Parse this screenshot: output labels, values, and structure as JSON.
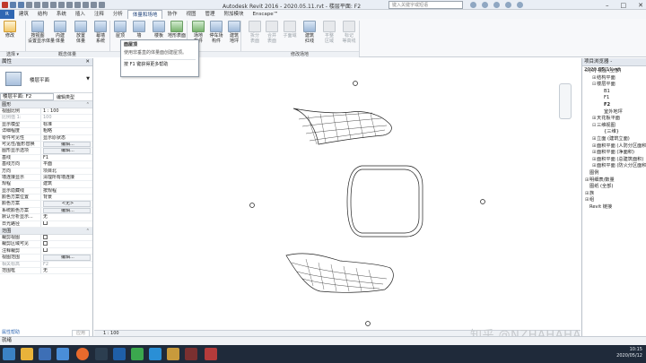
{
  "app": {
    "title": "Autodesk Revit 2016 -    2020.05.11.rvt - 楼层平面: F2",
    "search_placeholder": "键入关键字或短语"
  },
  "menu_tabs": [
    "建筑",
    "结构",
    "系统",
    "插入",
    "注释",
    "分析",
    "体量和场地",
    "协作",
    "视图",
    "管理",
    "附加模块",
    "Enscape™"
  ],
  "active_tab": "体量和场地",
  "ribbon": {
    "tools": [
      {
        "l1": "修改",
        "l2": "",
        "state": "sel"
      },
      {
        "l1": "按视图",
        "l2": "设置显示体量",
        "state": ""
      },
      {
        "l1": "内建",
        "l2": "体量",
        "state": ""
      },
      {
        "l1": "放置",
        "l2": "体量",
        "state": ""
      },
      {
        "l1": "幕墙",
        "l2": "系统",
        "state": ""
      },
      {
        "l1": "屋顶",
        "l2": "",
        "state": ""
      },
      {
        "l1": "墙",
        "l2": "",
        "state": ""
      },
      {
        "l1": "楼板",
        "l2": "",
        "state": ""
      },
      {
        "l1": "地形表面",
        "l2": "",
        "state": "green"
      },
      {
        "l1": "场地",
        "l2": "构件",
        "state": "green"
      },
      {
        "l1": "停车场",
        "l2": "构件",
        "state": ""
      },
      {
        "l1": "建筑",
        "l2": "地坪",
        "state": ""
      },
      {
        "l1": "拆分",
        "l2": "表面",
        "state": "grey"
      },
      {
        "l1": "合并",
        "l2": "表面",
        "state": "grey"
      },
      {
        "l1": "子面域",
        "l2": "",
        "state": "grey"
      },
      {
        "l1": "建筑",
        "l2": "红线",
        "state": ""
      },
      {
        "l1": "平整",
        "l2": "区域",
        "state": "grey"
      },
      {
        "l1": "标记",
        "l2": "等高线",
        "state": "grey"
      }
    ],
    "panels": [
      "选择 ▾",
      "概念体量",
      "",
      "",
      "修改场地"
    ]
  },
  "tooltip": {
    "title": "面屋顶",
    "desc": "使用非垂直的体量面创建屋顶。",
    "help": "按 F1 键获得更多帮助"
  },
  "properties": {
    "header": "属性",
    "close": "✕",
    "type_name": "楼层平面",
    "instance_selector": "楼层平面: F2",
    "edit_type": "编辑类型",
    "groups": [
      {
        "name": "图形",
        "rows": [
          {
            "k": "视图比例",
            "v": "1 : 100",
            "d": false
          },
          {
            "k": "比例值 1:",
            "v": "100",
            "d": true
          },
          {
            "k": "显示模型",
            "v": "标准",
            "d": false
          },
          {
            "k": "详细程度",
            "v": "粗略",
            "d": false
          },
          {
            "k": "零件可见性",
            "v": "显示原状态",
            "d": false
          },
          {
            "k": "可见性/图形替换",
            "v": "编辑...",
            "d": false,
            "btn": true
          },
          {
            "k": "图形显示选项",
            "v": "编辑...",
            "d": false,
            "btn": true
          },
          {
            "k": "基线",
            "v": "F1",
            "d": false
          },
          {
            "k": "基线方向",
            "v": "平面",
            "d": false
          },
          {
            "k": "方向",
            "v": "项目北",
            "d": false
          },
          {
            "k": "墙连接显示",
            "v": "清理所有墙连接",
            "d": false
          },
          {
            "k": "规程",
            "v": "建筑",
            "d": false
          },
          {
            "k": "显示隐藏线",
            "v": "按规程",
            "d": false
          },
          {
            "k": "颜色方案位置",
            "v": "背景",
            "d": false
          },
          {
            "k": "颜色方案",
            "v": "<无>",
            "d": false,
            "btn": true
          },
          {
            "k": "系统颜色方案",
            "v": "编辑...",
            "d": false,
            "btn": true
          },
          {
            "k": "默认分析显示...",
            "v": "无",
            "d": false
          },
          {
            "k": "日光路径",
            "v": "",
            "d": false,
            "cb": true
          }
        ]
      },
      {
        "name": "范围",
        "rows": [
          {
            "k": "裁剪视图",
            "v": "",
            "d": false,
            "cb": true
          },
          {
            "k": "裁剪区域可见",
            "v": "",
            "d": false,
            "cb": true
          },
          {
            "k": "注释裁剪",
            "v": "",
            "d": false,
            "cb": true
          },
          {
            "k": "视图范围",
            "v": "编辑...",
            "d": false,
            "btn": true
          },
          {
            "k": "相关标高",
            "v": "F2",
            "d": true
          },
          {
            "k": "范围框",
            "v": "无",
            "d": false
          }
        ]
      }
    ],
    "footer_link": "属性帮助",
    "apply": "应用"
  },
  "browser": {
    "header": "项目浏览器 - 2020.05.11.rvt",
    "nodes": [
      {
        "t": "[0] 视图 (全部)",
        "lv": 0,
        "tg": "⊟"
      },
      {
        "t": "结构平面",
        "lv": 1,
        "tg": "⊞"
      },
      {
        "t": "楼层平面",
        "lv": 1,
        "tg": "⊟"
      },
      {
        "t": "B1",
        "lv": 2,
        "tg": ""
      },
      {
        "t": "F1",
        "lv": 2,
        "tg": ""
      },
      {
        "t": "F2",
        "lv": 2,
        "tg": "",
        "bold": true
      },
      {
        "t": "室外地坪",
        "lv": 2,
        "tg": ""
      },
      {
        "t": "天花板平面",
        "lv": 1,
        "tg": "⊞"
      },
      {
        "t": "三维视图",
        "lv": 1,
        "tg": "⊟"
      },
      {
        "t": "{三维}",
        "lv": 2,
        "tg": ""
      },
      {
        "t": "立面 (建筑立面)",
        "lv": 1,
        "tg": "⊞"
      },
      {
        "t": "面积平面 (人防分区面积)",
        "lv": 1,
        "tg": "⊞"
      },
      {
        "t": "面积平面 (净面积)",
        "lv": 1,
        "tg": "⊞"
      },
      {
        "t": "面积平面 (总建筑面积)",
        "lv": 1,
        "tg": "⊞"
      },
      {
        "t": "面积平面 (防火分区面积)",
        "lv": 1,
        "tg": "⊞"
      },
      {
        "t": "图例",
        "lv": 0,
        "tg": ""
      },
      {
        "t": "明细表/数量",
        "lv": 0,
        "tg": "⊞"
      },
      {
        "t": "图纸 (全部)",
        "lv": 0,
        "tg": ""
      },
      {
        "t": "族",
        "lv": 0,
        "tg": "⊞"
      },
      {
        "t": "组",
        "lv": 0,
        "tg": "⊞"
      },
      {
        "t": "Revit 链接",
        "lv": 0,
        "tg": ""
      }
    ]
  },
  "viewbar": {
    "scale": "1 : 100"
  },
  "status": {
    "text": "就绪"
  },
  "tray": {
    "time": "10:15",
    "date": "2020/05/12"
  },
  "watermark": "知乎 @NZHAHAHA",
  "colors": {
    "file_tab": "#2f67b3",
    "taskbar": "#1f2a3a"
  }
}
